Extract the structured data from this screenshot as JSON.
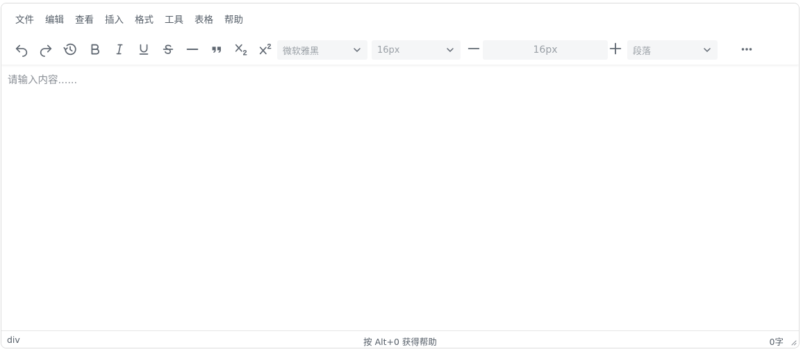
{
  "menubar": {
    "items": [
      {
        "label": "文件"
      },
      {
        "label": "编辑"
      },
      {
        "label": "查看"
      },
      {
        "label": "插入"
      },
      {
        "label": "格式"
      },
      {
        "label": "工具"
      },
      {
        "label": "表格"
      },
      {
        "label": "帮助"
      }
    ]
  },
  "toolbar": {
    "buttons": [
      {
        "icon": "undo-icon"
      },
      {
        "icon": "redo-icon"
      },
      {
        "icon": "history-icon"
      },
      {
        "icon": "bold-icon"
      },
      {
        "icon": "italic-icon"
      },
      {
        "icon": "underline-icon"
      },
      {
        "icon": "strikethrough-icon"
      },
      {
        "icon": "horizontal-rule-icon"
      },
      {
        "icon": "blockquote-icon"
      },
      {
        "icon": "subscript-icon"
      },
      {
        "icon": "superscript-icon"
      }
    ],
    "font_family": "微软雅黑",
    "font_size": "16px",
    "font_size_input": "16px",
    "block_format": "段落",
    "more_icon": "more-horizontal-icon"
  },
  "content": {
    "placeholder": "请输入内容......"
  },
  "statusbar": {
    "path": "div",
    "help": "按 Alt+0 获得帮助",
    "word_count": "0字"
  },
  "colors": {
    "icon": "#5f6771",
    "select_bg": "#f5f6f7",
    "border": "#dcdcdc",
    "placeholder": "#8a8f96"
  }
}
